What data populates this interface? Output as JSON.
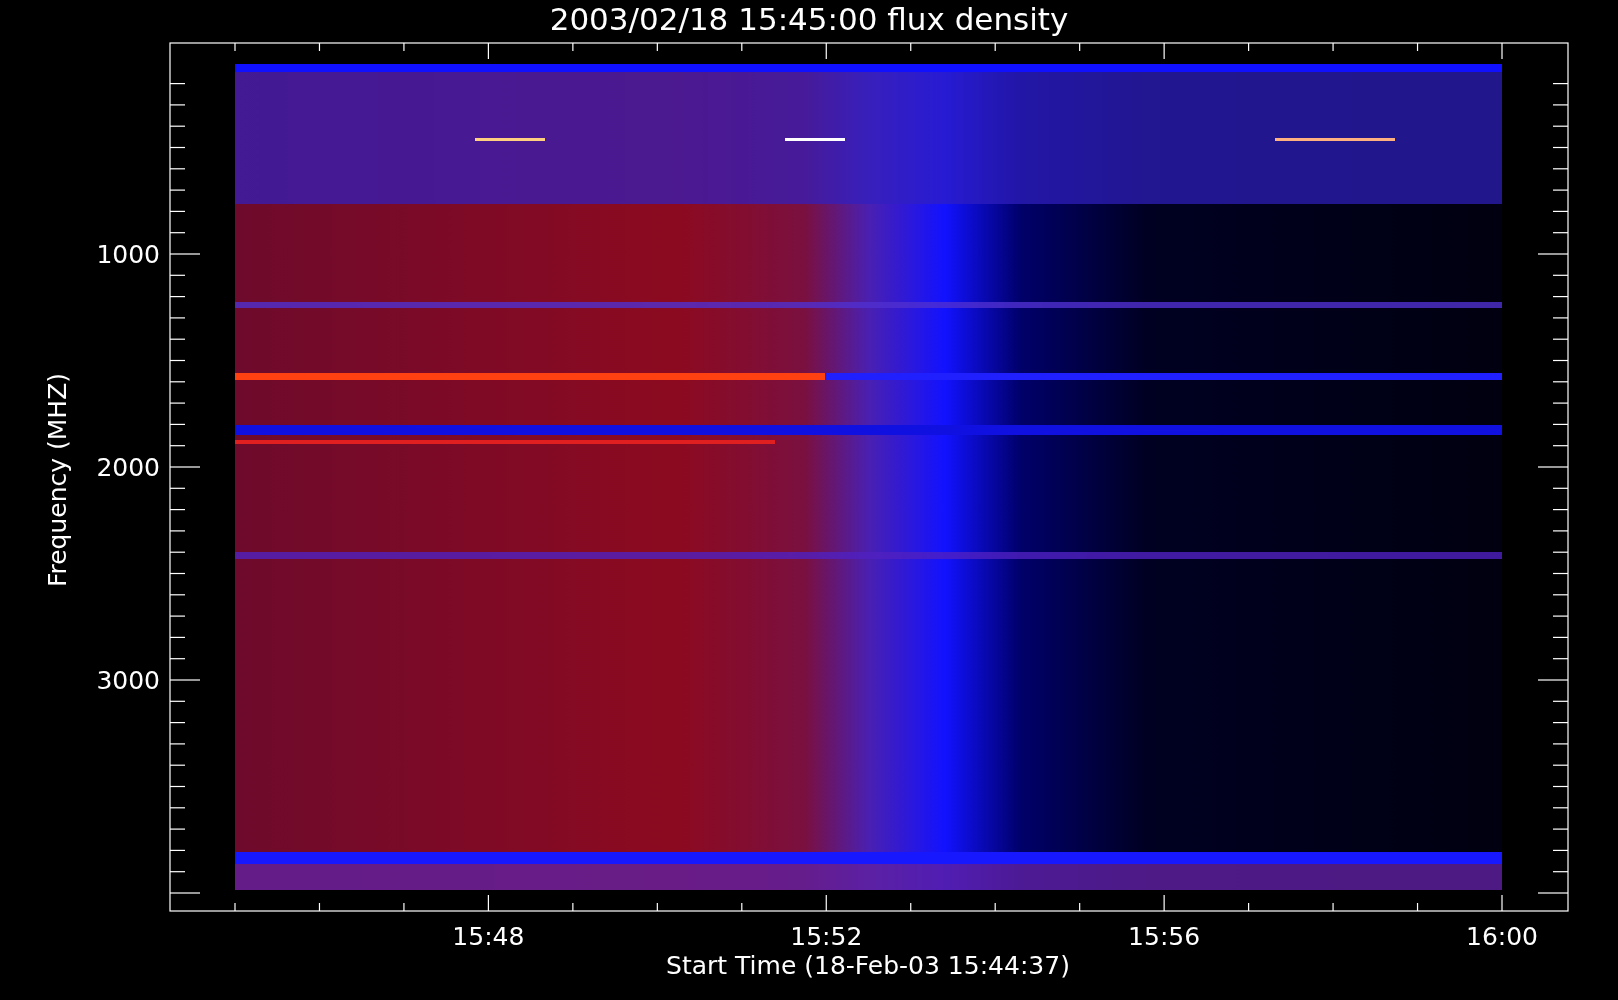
{
  "title": "2003/02/18 15:45:00 flux density",
  "x_axis": {
    "label": "Start Time (18-Feb-03 15:44:37)",
    "ticks": [
      "15:48",
      "15:52",
      "15:56",
      "16:00"
    ]
  },
  "y_axis": {
    "label": "Frequency (MHZ)",
    "ticks": [
      "1000",
      "2000",
      "3000"
    ]
  }
}
